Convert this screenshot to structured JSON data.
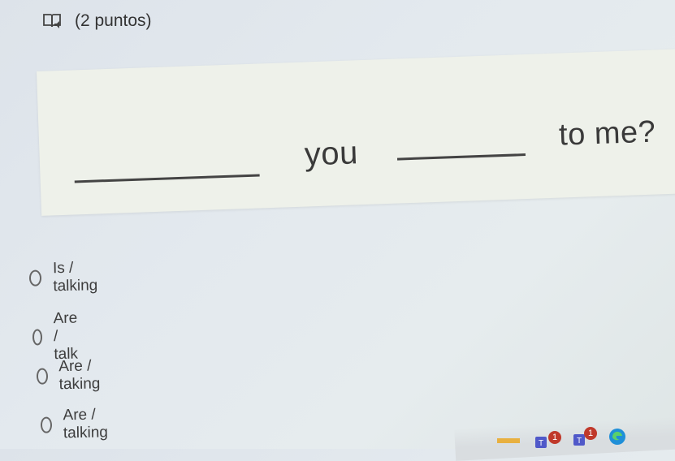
{
  "question": {
    "points_label": "(2 puntos)",
    "icon": "immersive-reader-icon",
    "sentence": {
      "word_1": "you",
      "word_2": "to me?"
    }
  },
  "options": [
    {
      "label": "Is / talking"
    },
    {
      "label": "Are / talk"
    },
    {
      "label": "Are / taking"
    },
    {
      "label": "Are / talking"
    }
  ],
  "taskbar": {
    "icons": [
      "teams-icon",
      "teams-icon",
      "edge-icon"
    ],
    "badges": [
      "1",
      "1"
    ]
  }
}
